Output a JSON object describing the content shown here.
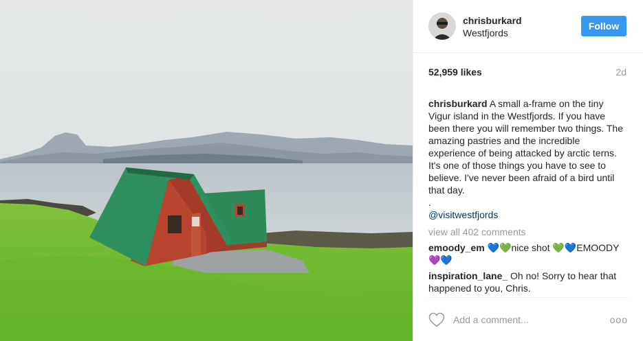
{
  "post": {
    "username": "chrisburkard",
    "location": "Westfjords",
    "follow_label": "Follow",
    "likes": "52,959 likes",
    "age": "2d",
    "caption": {
      "author": "chrisburkard",
      "text": "A small a-frame on the tiny Vigur island in the Westfjords. If you have been there you will remember two things. The amazing pastries and the incredible experience of being attacked by arctic terns. It's one of those things you have to see to believe. I've never been afraid of a bird until that day.",
      "dot": ".",
      "tag": "@visitwestfjords"
    },
    "view_all": "view all 402 comments",
    "comments": [
      {
        "author": "emoody_em",
        "text_a": "nice shot ",
        "text_b": "EMOODY",
        "emoji": [
          "💙💚",
          "💚💙",
          "💜💙"
        ]
      },
      {
        "author": "inspiration_lane_",
        "text": "Oh no! Sorry to hear that happened to you, Chris."
      }
    ],
    "add_comment_placeholder": "Add a comment...",
    "more": "ooo"
  },
  "icons": {
    "avatar": "avatar-photo",
    "like": "heart-outline-icon",
    "more": "more-options-icon"
  }
}
